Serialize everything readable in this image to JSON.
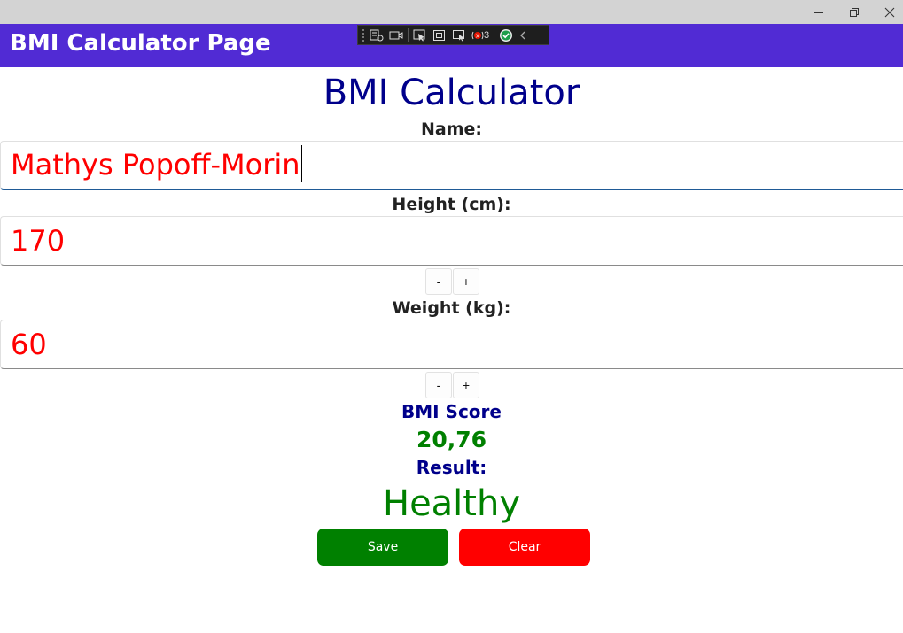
{
  "window": {
    "minimize_icon": "minimize-icon",
    "restore_icon": "restore-icon",
    "close_icon": "close-icon"
  },
  "header": {
    "title": "BMI Calculator Page",
    "color": "#512bd4"
  },
  "debug_toolbar": {
    "counter": "3"
  },
  "main": {
    "title": "BMI Calculator",
    "name": {
      "label": "Name:",
      "value": "Mathys Popoff-Morin"
    },
    "height": {
      "label": "Height (cm):",
      "value": "170",
      "minus": "-",
      "plus": "+"
    },
    "weight": {
      "label": "Weight (kg):",
      "value": "60",
      "minus": "-",
      "plus": "+"
    },
    "score": {
      "label": "BMI Score",
      "value": "20,76"
    },
    "result": {
      "label": "Result:",
      "value": "Healthy"
    },
    "save_label": "Save",
    "clear_label": "Clear"
  },
  "colors": {
    "accent": "#512bd4",
    "title": "#00008b",
    "input_text": "#ff0000",
    "healthy": "#008000",
    "save": "#008000",
    "clear": "#ff0000"
  }
}
